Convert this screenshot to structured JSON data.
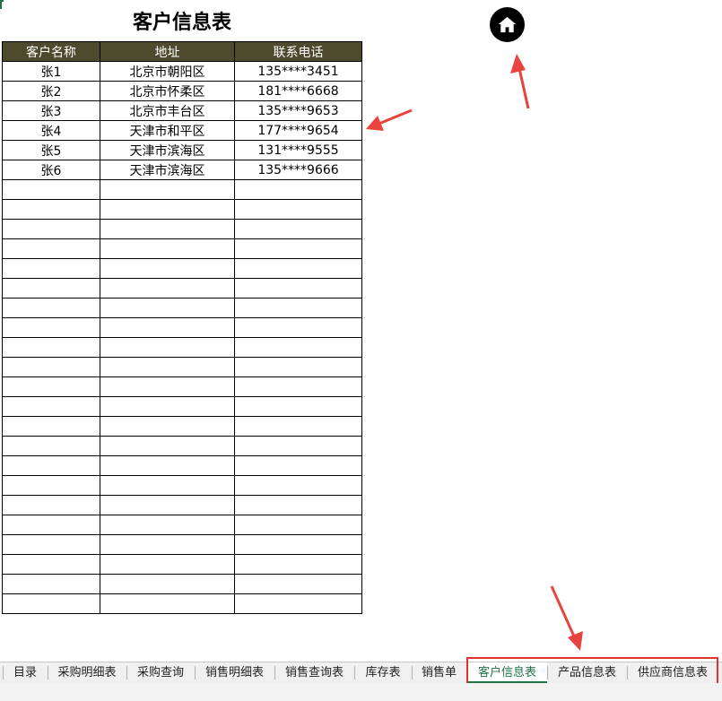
{
  "sheet": {
    "title": "客户信息表",
    "columns": [
      "客户名称",
      "地址",
      "联系电话"
    ],
    "rows": [
      [
        "张1",
        "北京市朝阳区",
        "135****3451"
      ],
      [
        "张2",
        "北京市怀柔区",
        "181****6668"
      ],
      [
        "张3",
        "北京市丰台区",
        "135****9653"
      ],
      [
        "张4",
        "天津市和平区",
        "177****9654"
      ],
      [
        "张5",
        "天津市滨海区",
        "131****9555"
      ],
      [
        "张6",
        "天津市滨海区",
        "135****9666"
      ],
      [
        "",
        "",
        ""
      ],
      [
        "",
        "",
        ""
      ],
      [
        "",
        "",
        ""
      ],
      [
        "",
        "",
        ""
      ],
      [
        "",
        "",
        ""
      ],
      [
        "",
        "",
        ""
      ],
      [
        "",
        "",
        ""
      ],
      [
        "",
        "",
        ""
      ],
      [
        "",
        "",
        ""
      ],
      [
        "",
        "",
        ""
      ],
      [
        "",
        "",
        ""
      ],
      [
        "",
        "",
        ""
      ],
      [
        "",
        "",
        ""
      ],
      [
        "",
        "",
        ""
      ],
      [
        "",
        "",
        ""
      ],
      [
        "",
        "",
        ""
      ],
      [
        "",
        "",
        ""
      ],
      [
        "",
        "",
        ""
      ],
      [
        "",
        "",
        ""
      ],
      [
        "",
        "",
        ""
      ],
      [
        "",
        "",
        ""
      ],
      [
        "",
        "",
        ""
      ]
    ],
    "header_color": "#4d4a2e"
  },
  "home_button": {
    "icon": "home-icon"
  },
  "annotations": {
    "arrow_color": "#e8433f",
    "box_color": "#e03030"
  },
  "tabs": [
    {
      "label": "目录",
      "active": false
    },
    {
      "label": "采购明细表",
      "active": false
    },
    {
      "label": "采购查询",
      "active": false
    },
    {
      "label": "销售明细表",
      "active": false
    },
    {
      "label": "销售查询表",
      "active": false
    },
    {
      "label": "库存表",
      "active": false
    },
    {
      "label": "销售单",
      "active": false
    },
    {
      "label": "客户信息表",
      "active": true
    },
    {
      "label": "产品信息表",
      "active": false
    },
    {
      "label": "供应商信息表",
      "active": false
    }
  ],
  "accent_color": "#217346"
}
